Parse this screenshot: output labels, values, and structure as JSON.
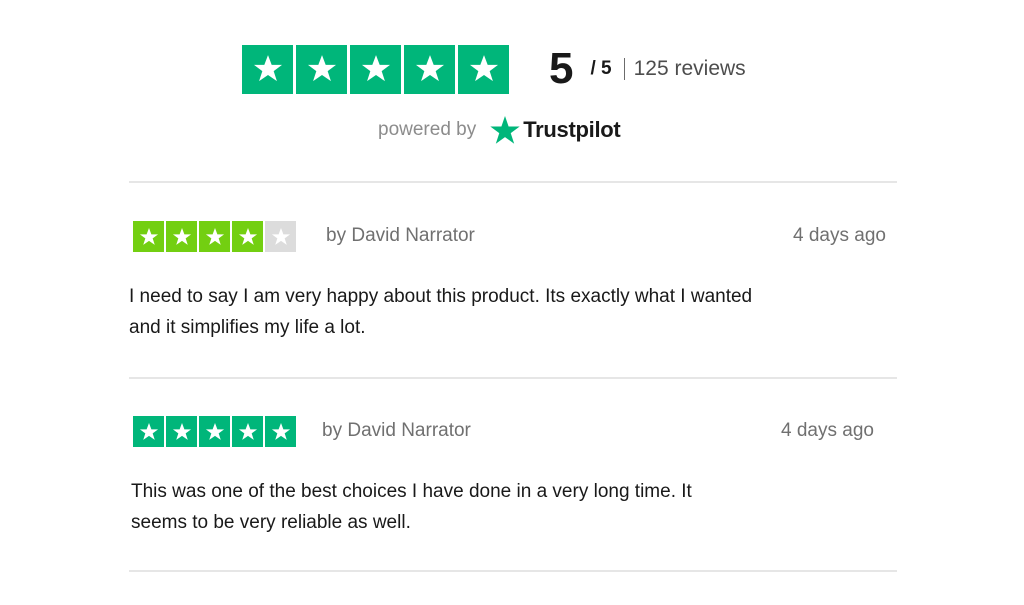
{
  "summary": {
    "rating_value": "5",
    "rating_scale": "/ 5",
    "review_count": "125 reviews",
    "stars_filled": 5,
    "stars_total": 5
  },
  "branding": {
    "powered_by": "powered by",
    "brand": "Trustpilot",
    "brand_icon": "trustpilot-star-icon"
  },
  "reviews": [
    {
      "stars_filled": 4,
      "stars_total": 5,
      "author": "by David Narrator",
      "date": "4 days ago",
      "text_line1": "I need to say I am very happy about this product. Its exactly what I wanted",
      "text_line2": "and it simplifies my life a lot."
    },
    {
      "stars_filled": 5,
      "stars_total": 5,
      "author": "by David Narrator",
      "date": "4 days ago",
      "text_line1": "This was one of the best choices I have done in a very long time. It",
      "text_line2": "seems to be very reliable as well."
    }
  ],
  "colors": {
    "trustpilot_green": "#00b67a",
    "four_star_green": "#73cf11",
    "empty_star": "#dcdcdc",
    "divider": "#e6e6e6"
  }
}
